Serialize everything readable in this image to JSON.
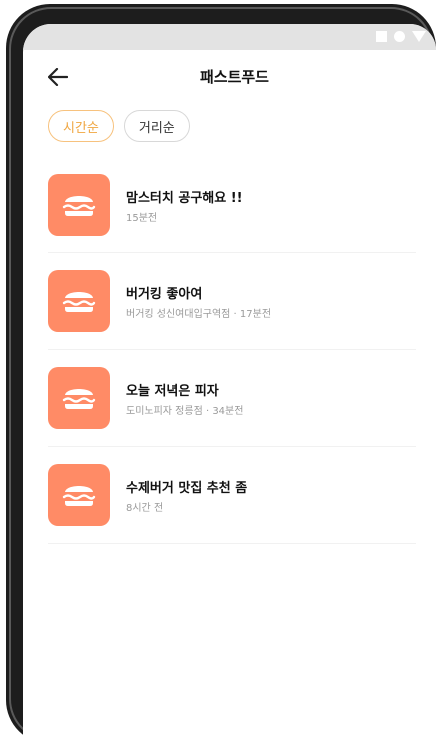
{
  "status_bar": {
    "icons": [
      "square-icon",
      "circle-icon",
      "triangle-icon"
    ]
  },
  "header": {
    "title": "패스트푸드",
    "back_icon": "arrow-left-icon"
  },
  "filters": [
    {
      "label": "시간순",
      "active": true
    },
    {
      "label": "거리순",
      "active": false
    }
  ],
  "items": [
    {
      "title": "맘스터치 공구해요 !!",
      "subtitle": "15분전",
      "icon": "burger-icon"
    },
    {
      "title": "버거킹 좋아여",
      "subtitle": "버거킹 성신여대입구역점 · 17분전",
      "icon": "burger-icon"
    },
    {
      "title": "오늘 저녁은 피자",
      "subtitle": "도미노피자 정릉점 · 34분전",
      "icon": "burger-icon"
    },
    {
      "title": "수제버거 맛집 추천 좀",
      "subtitle": "8시간 전",
      "icon": "burger-icon"
    }
  ],
  "colors": {
    "accent": "#f0a640",
    "thumb": "#ff8b66"
  }
}
